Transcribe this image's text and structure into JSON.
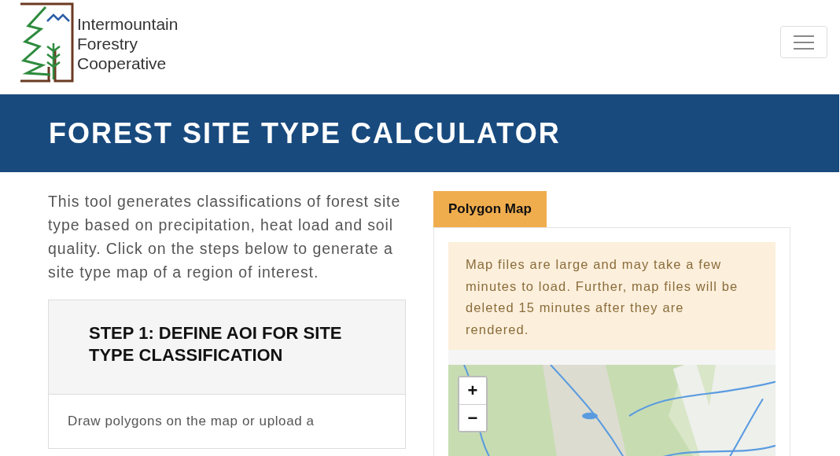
{
  "logo": {
    "lines": [
      "Intermountain",
      "Forestry",
      "Cooperative"
    ]
  },
  "banner": {
    "title": "FOREST SITE TYPE CALCULATOR"
  },
  "intro": "This tool generates classifications of forest site type based on precipitation, heat load and soil quality. Click on the steps below to generate a site type map of a region of interest.",
  "step": {
    "title": "STEP 1: DEFINE AOI FOR SITE TYPE CLASSIFICATION",
    "body": "Draw polygons on the map or upload a"
  },
  "tabs": [
    {
      "label": "Polygon Map",
      "selected": true
    }
  ],
  "alert": "Map files are large and may take a few minutes to load. Further, map files will be deleted 15 minutes after they are rendered.",
  "map": {
    "kind": "picture",
    "zoom_in": "+",
    "zoom_out": "−"
  }
}
